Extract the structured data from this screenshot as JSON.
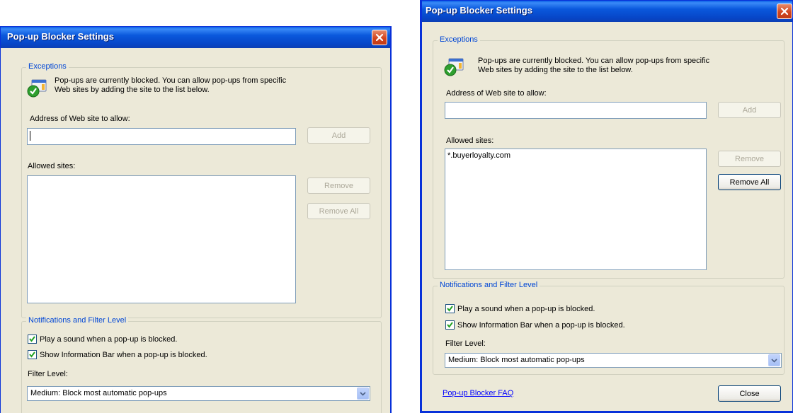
{
  "dialog_title": "Pop-up Blocker Settings",
  "exceptions": {
    "legend": "Exceptions",
    "info_line1": "Pop-ups are currently blocked.  You can allow pop-ups from specific",
    "info_line2": "Web sites by adding the site to the list below.",
    "address_label": "Address of Web site to allow:",
    "address_value": "",
    "add_label": "Add",
    "allowed_label": "Allowed sites:",
    "remove_label": "Remove",
    "remove_all_label": "Remove All"
  },
  "right_allowed_sites": [
    "*.buyerloyalty.com"
  ],
  "notifications": {
    "legend": "Notifications and Filter Level",
    "play_sound_label": "Play a sound when a pop-up is blocked.",
    "play_sound_checked": true,
    "info_bar_label": "Show Information Bar when a pop-up is blocked.",
    "info_bar_checked": true,
    "filter_label": "Filter Level:",
    "filter_value": "Medium: Block most automatic pop-ups"
  },
  "footer": {
    "faq_link": "Pop-up Blocker FAQ",
    "close_label": "Close"
  },
  "icons": {
    "close": "close-icon",
    "shield": "shield-check-icon",
    "dropdown": "chevron-down-icon"
  },
  "colors": {
    "titlebar": "#0a58dc",
    "dialog_bg": "#ece9d8",
    "close_button": "#d2451f",
    "group_legend": "#0046d5"
  }
}
